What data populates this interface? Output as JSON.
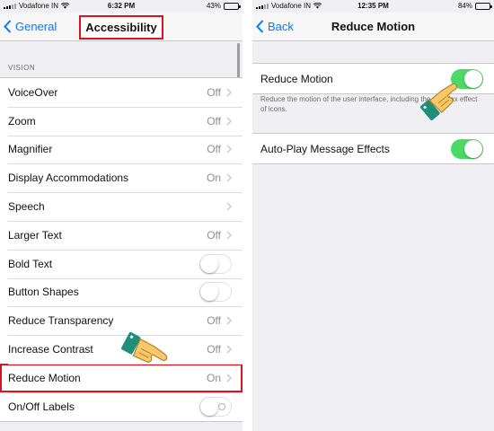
{
  "left": {
    "status": {
      "carrier": "Vodafone IN",
      "time": "6:32 PM",
      "battery": "43%",
      "battery_level": 0.43
    },
    "nav": {
      "back_label": "General",
      "title": "Accessibility"
    },
    "section_header": "VISION",
    "rows": [
      {
        "label": "VoiceOver",
        "value": "Off",
        "kind": "disclosure"
      },
      {
        "label": "Zoom",
        "value": "Off",
        "kind": "disclosure"
      },
      {
        "label": "Magnifier",
        "value": "Off",
        "kind": "disclosure"
      },
      {
        "label": "Display Accommodations",
        "value": "On",
        "kind": "disclosure"
      },
      {
        "label": "Speech",
        "value": "",
        "kind": "disclosure"
      },
      {
        "label": "Larger Text",
        "value": "Off",
        "kind": "disclosure"
      },
      {
        "label": "Bold Text",
        "kind": "toggle",
        "on": false
      },
      {
        "label": "Button Shapes",
        "kind": "toggle",
        "on": false
      },
      {
        "label": "Reduce Transparency",
        "value": "Off",
        "kind": "disclosure"
      },
      {
        "label": "Increase Contrast",
        "value": "Off",
        "kind": "disclosure"
      },
      {
        "label": "Reduce Motion",
        "value": "On",
        "kind": "disclosure",
        "highlighted": true
      },
      {
        "label": "On/Off Labels",
        "kind": "toggle",
        "on": false
      }
    ]
  },
  "right": {
    "status": {
      "carrier": "Vodafone IN",
      "time": "12:35 PM",
      "battery": "84%",
      "battery_level": 0.84
    },
    "nav": {
      "back_label": "Back",
      "title": "Reduce Motion"
    },
    "reduce_motion": {
      "label": "Reduce Motion",
      "on": true
    },
    "footer": "Reduce the motion of the user interface, including the parallax effect of icons.",
    "auto_play": {
      "label": "Auto-Play Message Effects",
      "on": true
    }
  },
  "colors": {
    "accent": "#007aff",
    "toggle_on": "#4cd964",
    "highlight": "#e0101e"
  },
  "icons": {
    "back": "chevron-left-icon",
    "disclosure": "chevron-right-icon",
    "pointer": "pointing-hand-icon"
  }
}
